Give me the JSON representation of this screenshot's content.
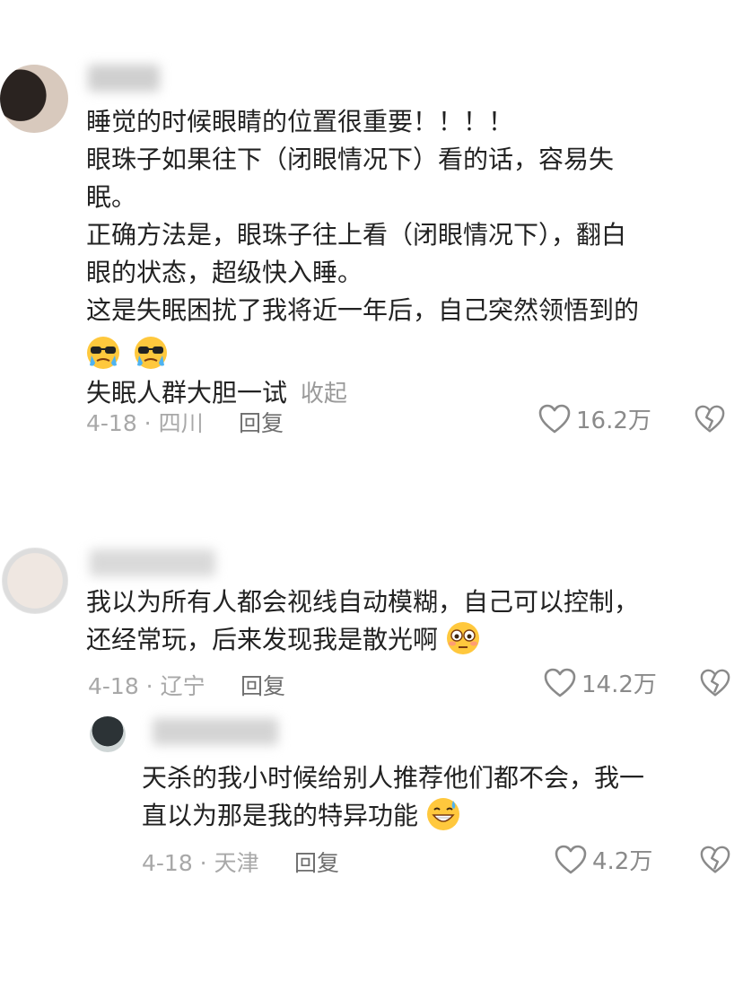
{
  "comments": [
    {
      "lines": [
        "睡觉的时候眼睛的位置很重要！！！！",
        "眼珠子如果往下（闭眼情况下）看的话，容易失",
        "眠。",
        "正确方法是，眼珠子往上看（闭眼情况下），翻白",
        "眼的状态，超级快入睡。",
        "这是失眠困扰了我将近一年后，自己突然领悟到的"
      ],
      "emojis": [
        "cool-crying-emoji",
        "cool-crying-emoji"
      ],
      "last_line": "失眠人群大胆一试",
      "collapse_label": "收起",
      "date_location": "4-18 · 四川",
      "reply_label": "回复",
      "likes": "16.2万"
    },
    {
      "lines": [
        "我以为所有人都会视线自动模糊，自己可以控制，",
        "还经常玩，后来发现我是散光啊"
      ],
      "emoji": "flushed-face-emoji",
      "date_location": "4-18 · 辽宁",
      "reply_label": "回复",
      "likes": "14.2万"
    },
    {
      "lines": [
        "天杀的我小时候给别人推荐他们都不会，我一",
        "直以为那是我的特异功能"
      ],
      "emoji": "grinning-sweat-emoji",
      "date_location": "4-18 · 天津",
      "reply_label": "回复",
      "likes": "4.2万"
    }
  ],
  "colors": {
    "text": "#222222",
    "meta": "#a8a8a8",
    "reply": "#6e6e6e",
    "icon": "#8a8a8a"
  }
}
